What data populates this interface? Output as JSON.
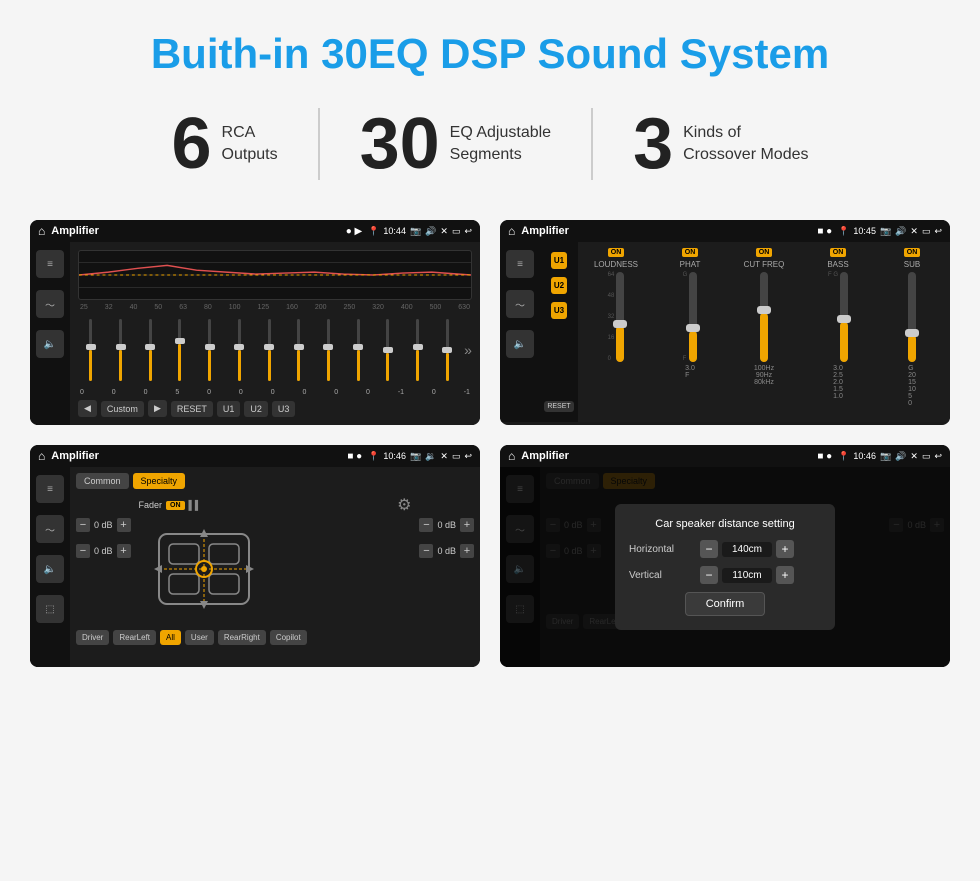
{
  "page": {
    "title": "Buith-in 30EQ DSP Sound System"
  },
  "features": [
    {
      "number": "6",
      "text_line1": "RCA",
      "text_line2": "Outputs"
    },
    {
      "number": "30",
      "text_line1": "EQ Adjustable",
      "text_line2": "Segments"
    },
    {
      "number": "3",
      "text_line1": "Kinds of",
      "text_line2": "Crossover Modes"
    }
  ],
  "screens": [
    {
      "id": "eq-screen",
      "status_bar": {
        "app": "Amplifier",
        "time": "10:44"
      },
      "eq_labels": [
        "25",
        "32",
        "40",
        "50",
        "63",
        "80",
        "100",
        "125",
        "160",
        "200",
        "250",
        "320",
        "400",
        "500",
        "630"
      ],
      "eq_values": [
        "0",
        "0",
        "0",
        "5",
        "0",
        "0",
        "0",
        "0",
        "0",
        "0",
        "-1",
        "0",
        "-1"
      ],
      "preset_label": "Custom",
      "buttons": [
        "RESET",
        "U1",
        "U2",
        "U3"
      ]
    },
    {
      "id": "crossover-screen",
      "status_bar": {
        "app": "Amplifier",
        "time": "10:45"
      },
      "presets": [
        "U1",
        "U2",
        "U3"
      ],
      "channels": [
        {
          "label": "LOUDNESS",
          "on": true
        },
        {
          "label": "PHAT",
          "on": true
        },
        {
          "label": "CUT FREQ",
          "on": true
        },
        {
          "label": "BASS",
          "on": true
        },
        {
          "label": "SUB",
          "on": true
        }
      ],
      "reset_label": "RESET"
    },
    {
      "id": "fader-screen",
      "status_bar": {
        "app": "Amplifier",
        "time": "10:46"
      },
      "tabs": [
        "Common",
        "Specialty"
      ],
      "active_tab": "Specialty",
      "fader_label": "Fader",
      "fader_on": "ON",
      "vol_groups": [
        {
          "value": "0 dB"
        },
        {
          "value": "0 dB"
        },
        {
          "value": "0 dB"
        },
        {
          "value": "0 dB"
        }
      ],
      "bottom_buttons": [
        "Driver",
        "RearLeft",
        "All",
        "User",
        "RearRight",
        "Copilot"
      ]
    },
    {
      "id": "fader-dialog-screen",
      "status_bar": {
        "app": "Amplifier",
        "time": "10:46"
      },
      "tabs": [
        "Common",
        "Specialty"
      ],
      "active_tab": "Specialty",
      "fader_on": "ON",
      "dialog": {
        "title": "Car speaker distance setting",
        "fields": [
          {
            "label": "Horizontal",
            "value": "140cm"
          },
          {
            "label": "Vertical",
            "value": "110cm"
          }
        ],
        "confirm_label": "Confirm"
      },
      "vol_groups": [
        {
          "value": "0 dB"
        },
        {
          "value": "0 dB"
        }
      ],
      "bottom_buttons": [
        "Driver",
        "RearLeft",
        "All",
        "User",
        "RearRight",
        "Copilot"
      ]
    }
  ]
}
